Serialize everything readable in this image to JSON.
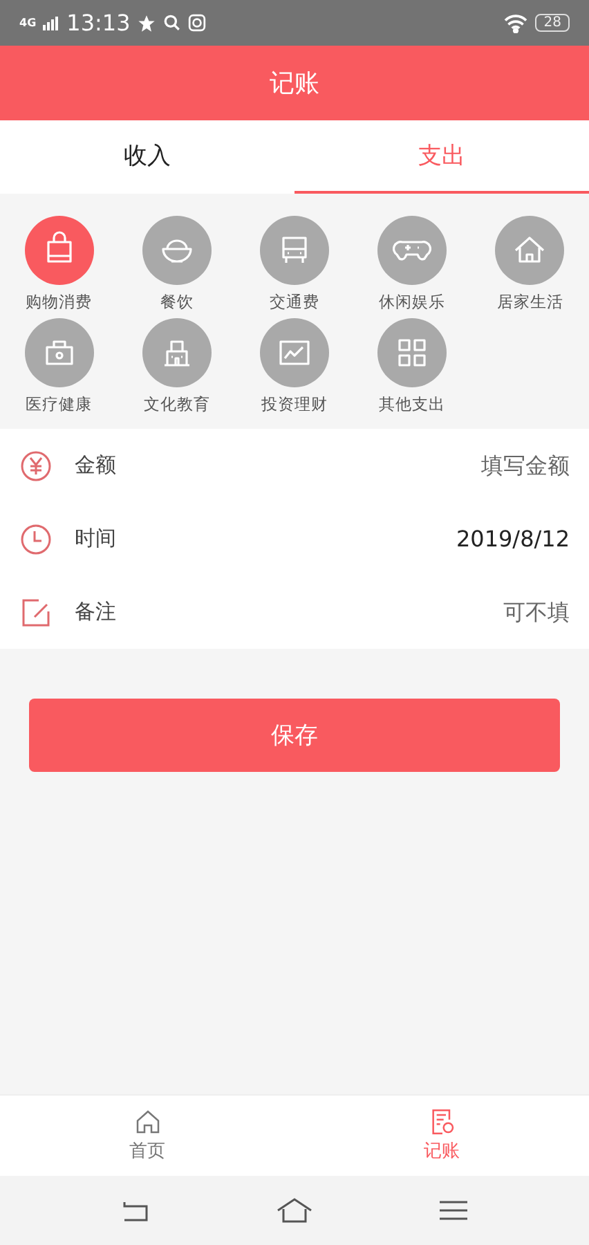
{
  "status_bar": {
    "network": "4G",
    "time": "13:13",
    "battery": "28"
  },
  "header": {
    "title": "记账"
  },
  "tabs": [
    {
      "label": "收入",
      "selected": false
    },
    {
      "label": "支出",
      "selected": true
    }
  ],
  "categories": [
    {
      "label": "购物消费",
      "selected": true
    },
    {
      "label": "餐饮",
      "selected": false
    },
    {
      "label": "交通费",
      "selected": false
    },
    {
      "label": "休闲娱乐",
      "selected": false
    },
    {
      "label": "居家生活",
      "selected": false
    },
    {
      "label": "医疗健康",
      "selected": false
    },
    {
      "label": "文化教育",
      "selected": false
    },
    {
      "label": "投资理财",
      "selected": false
    },
    {
      "label": "其他支出",
      "selected": false
    }
  ],
  "form": [
    {
      "kind": "amount",
      "label": "金额",
      "placeholder": "填写金额"
    },
    {
      "kind": "time",
      "label": "时间",
      "value": "2019/8/12"
    },
    {
      "kind": "note",
      "label": "备注",
      "placeholder": "可不填"
    }
  ],
  "save_button": "保存",
  "bottom_nav": [
    {
      "label": "首页",
      "selected": false
    },
    {
      "label": "记账",
      "selected": true
    }
  ]
}
